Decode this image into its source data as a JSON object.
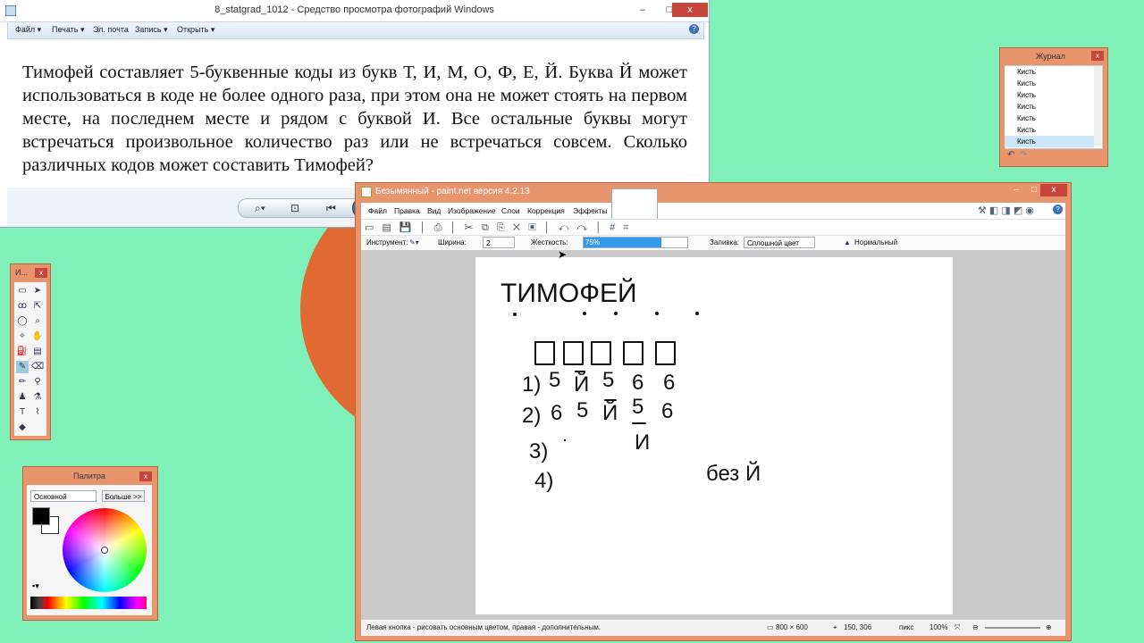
{
  "viewer": {
    "title": "8_statgrad_1012 - Средство просмотра фотографий Windows",
    "minimize": "–",
    "maximize": "□",
    "close": "x",
    "menu": [
      "Файл ▾",
      "Печать ▾",
      "Эл. почта",
      "Запись ▾",
      "Открыть ▾"
    ],
    "help": "?",
    "problem_text": "Тимофей составляет 5-буквенные коды из букв Т, И, М, О, Ф, Е, Й. Буква Й может использоваться в коде не более одного раза, при этом она не может стоять на первом месте, на последнем месте и рядом с буквой И. Все остальные буквы могут встречаться произвольное количество раз или не встречаться совсем. Сколько различных кодов может составить Тимофей?"
  },
  "paint": {
    "title": "Безымянный - paint.net версия 4.2.13",
    "minimize": "–",
    "maximize": "□",
    "close": "x",
    "menu": [
      "Файл",
      "Правка",
      "Вид",
      "Изображение",
      "Слои",
      "Коррекция",
      "Эффекты"
    ],
    "options": {
      "tool_label": "Инструмент:",
      "width_label": "Ширина:",
      "width_value": "2",
      "hardness_label": "Жесткость:",
      "hardness_value": "75%",
      "hardness_fraction": 0.75,
      "fill_label": "Заливка:",
      "fill_value": "Сплошной цвет",
      "blend_value": "Нормальный"
    },
    "status": {
      "hint": "Левая кнопка - рисовать основным цветом, правая - дополнительным.",
      "size": "800 × 600",
      "position": "150, 306",
      "unit": "пикс",
      "zoom": "100%"
    },
    "canvas_text": {
      "name": "ТИМОФЕЙ",
      "row1_label": "1)",
      "row1": [
        "5",
        "Й",
        "5",
        "6",
        "6"
      ],
      "row2_label": "2)",
      "row2": [
        "6",
        "5",
        "Й",
        "5",
        "6"
      ],
      "row2_extra": "И",
      "row3_label": "3)",
      "row4_label": "4)",
      "note": "без Й"
    }
  },
  "journal": {
    "title": "Журнал",
    "close": "x",
    "items": [
      "Кисть",
      "Кисть",
      "Кисть",
      "Кисть",
      "Кисть",
      "Кисть",
      "Кисть"
    ]
  },
  "tools_panel": {
    "title": "И...",
    "close": "x"
  },
  "palette": {
    "title": "Палитра",
    "close": "x",
    "mode": "Основной",
    "more": "Больше >>",
    "primary_color": "#000000",
    "secondary_color": "#ffffff"
  },
  "colors": {
    "desktop": "#7ff0b8",
    "accent_orange": "#e06a32",
    "window_frame": "#e8956e",
    "close_red": "#c7463c",
    "hardness_fill": "#3399ee"
  }
}
